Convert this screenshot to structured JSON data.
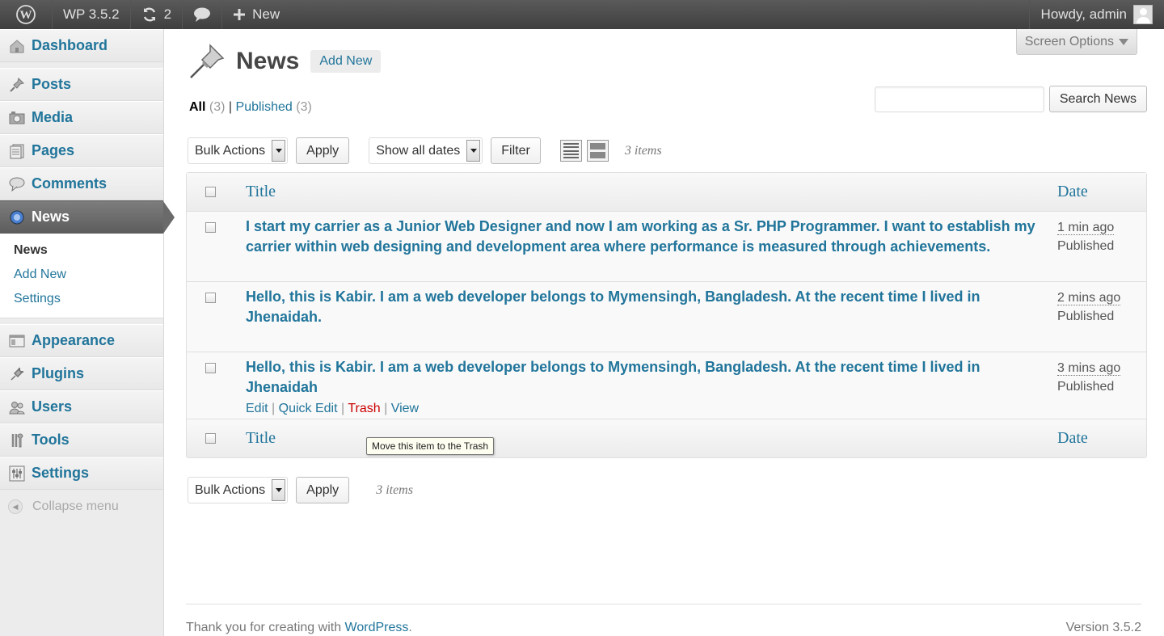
{
  "adminbar": {
    "site_name": "WP 3.5.2",
    "updates_count": "2",
    "new_label": "New",
    "howdy": "Howdy, admin"
  },
  "menu": {
    "items": [
      {
        "label": "Dashboard",
        "icon": "dashboard-icon"
      },
      {
        "label": "Posts",
        "icon": "posts-icon"
      },
      {
        "label": "Media",
        "icon": "media-icon"
      },
      {
        "label": "Pages",
        "icon": "pages-icon"
      },
      {
        "label": "Comments",
        "icon": "comments-icon"
      },
      {
        "label": "News",
        "icon": "news-icon"
      },
      {
        "label": "Appearance",
        "icon": "appearance-icon"
      },
      {
        "label": "Plugins",
        "icon": "plugins-icon"
      },
      {
        "label": "Users",
        "icon": "users-icon"
      },
      {
        "label": "Tools",
        "icon": "tools-icon"
      },
      {
        "label": "Settings",
        "icon": "settings-icon"
      }
    ],
    "submenu": [
      "News",
      "Add New",
      "Settings"
    ],
    "collapse": "Collapse menu"
  },
  "screen_options": "Screen Options",
  "page": {
    "title": "News",
    "add_new": "Add New"
  },
  "views": {
    "all": "All",
    "all_count": "(3)",
    "sep": "|",
    "published": "Published",
    "published_count": "(3)"
  },
  "search": {
    "button": "Search News",
    "value": ""
  },
  "tablenav": {
    "bulk_actions": "Bulk Actions",
    "apply": "Apply",
    "dates": "Show all dates",
    "filter": "Filter",
    "items": "3 items"
  },
  "table": {
    "col_title": "Title",
    "col_date": "Date",
    "rows": [
      {
        "title": "I start my carrier as a Junior Web Designer and now I am working as a Sr. PHP Programmer. I want to establish my carrier within web designing and development area where performance is measured through achievements.",
        "date": "1 min ago",
        "status": "Published"
      },
      {
        "title": "Hello, this is Kabir. I am a web developer belongs to Mymensingh, Bangladesh. At the recent time I lived in Jhenaidah.",
        "date": "2 mins ago",
        "status": "Published"
      },
      {
        "title": "Hello, this is Kabir. I am a web developer belongs to Mymensingh, Bangladesh. At the recent time I lived in Jhenaidah",
        "date": "3 mins ago",
        "status": "Published"
      }
    ],
    "row_actions": {
      "edit": "Edit",
      "quick_edit": "Quick Edit",
      "trash": "Trash",
      "view": "View",
      "sep": "|"
    }
  },
  "tooltip": "Move this item to the Trash",
  "footer": {
    "thanks": "Thank you for creating with",
    "wordpress": "WordPress",
    "period": ".",
    "version": "Version 3.5.2"
  },
  "colors": {
    "link": "#21759b",
    "trash": "#cc0000",
    "adminbar": "#464646"
  }
}
